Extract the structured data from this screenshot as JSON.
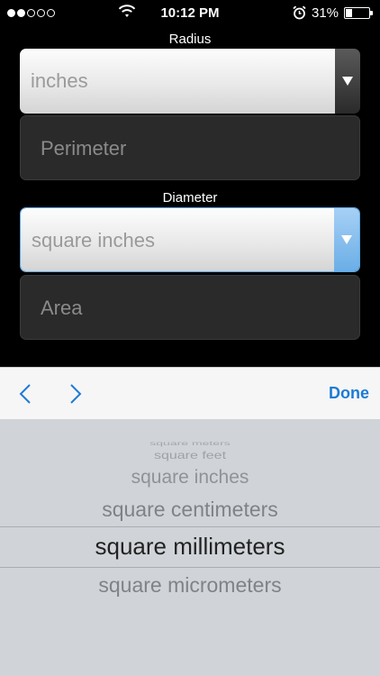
{
  "status_bar": {
    "signal": {
      "filled": 2,
      "total": 5
    },
    "time": "10:12 PM",
    "battery_percent": "31%",
    "battery_level": 0.31,
    "icons": [
      "wifi-icon",
      "alarm-icon",
      "battery-icon"
    ]
  },
  "fields": {
    "radius_label": "Radius",
    "radius_unit": "inches",
    "perimeter_placeholder": "Perimeter",
    "diameter_label": "Diameter",
    "diameter_unit": "square inches",
    "area_placeholder": "Area"
  },
  "toolbar": {
    "prev_icon": "chevron-left-icon",
    "next_icon": "chevron-right-icon",
    "done_label": "Done",
    "accent": "#1d7bd6"
  },
  "picker": {
    "options": [
      "square meters",
      "square feet",
      "square inches",
      "square centimeters",
      "square millimeters",
      "square micrometers"
    ],
    "selected": "square millimeters"
  }
}
